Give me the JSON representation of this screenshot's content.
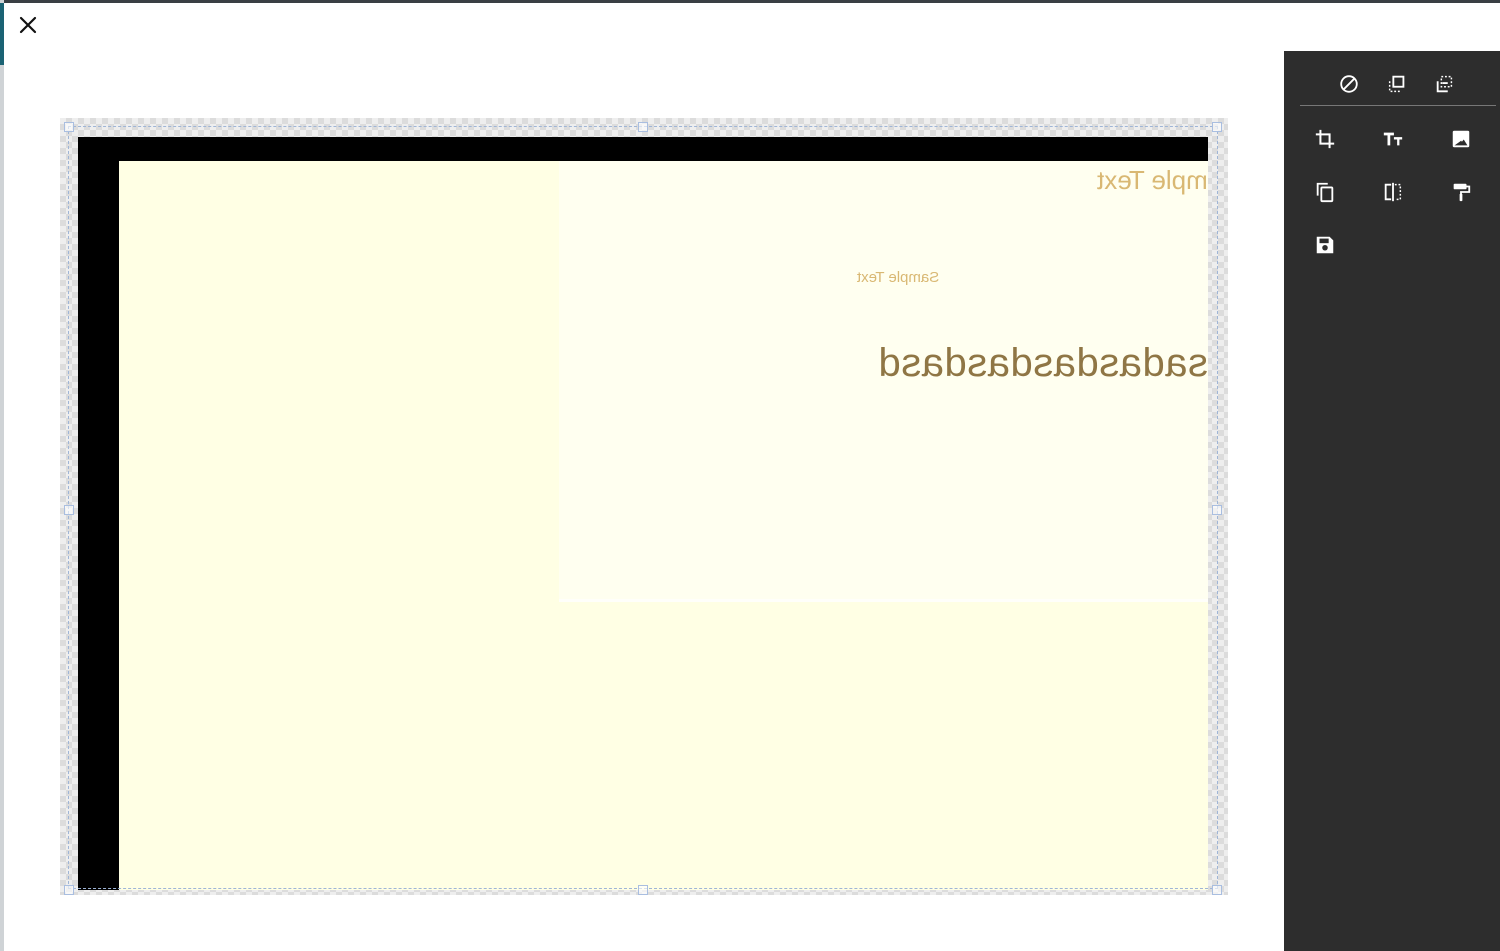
{
  "window": {
    "close_icon": "close-icon"
  },
  "canvas": {
    "texts": [
      {
        "text": "Sample Text",
        "visible": "mple Text",
        "mirrored": true
      },
      {
        "text": "Sample Text",
        "mirrored": true
      },
      {
        "text": "sadasdasdasdasd",
        "mirrored": true
      }
    ],
    "colors": {
      "frame": "#000000",
      "background": "#ffffe4",
      "text_light": "#d9b873",
      "text_dark": "#8f7645"
    }
  },
  "toolbar": {
    "top_tools": [
      "clear-icon",
      "bring-forward-icon",
      "send-backward-icon"
    ],
    "tools": [
      "crop-icon",
      "text-size-icon",
      "image-filter-icon",
      "duplicate-icon",
      "flip-horizontal-icon",
      "format-paint-icon",
      "save-icon"
    ],
    "background": "#2d2d2d"
  }
}
